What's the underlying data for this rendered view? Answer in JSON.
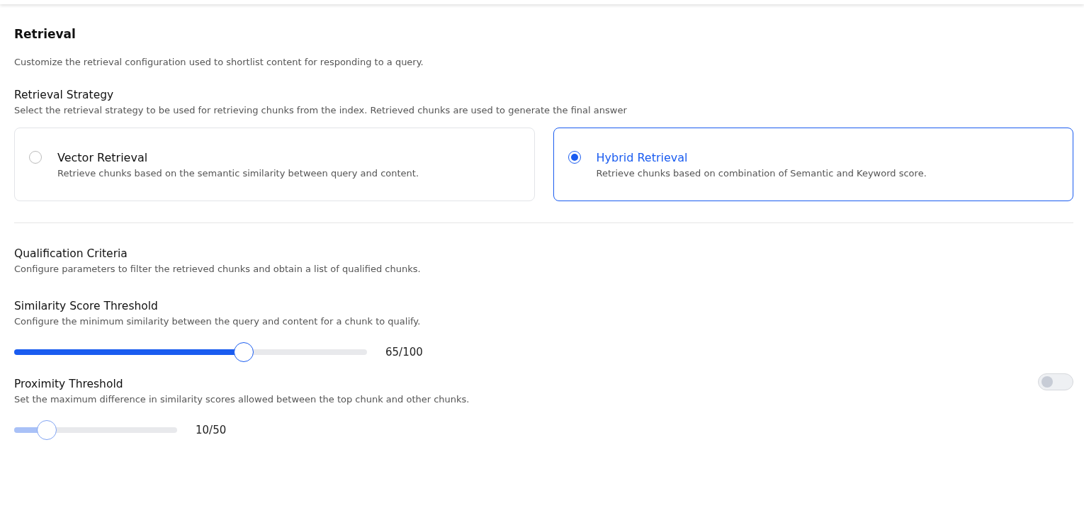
{
  "section": {
    "title": "Retrieval",
    "description": "Customize the retrieval configuration used to shortlist content for responding to a query."
  },
  "strategy": {
    "title": "Retrieval Strategy",
    "description": "Select the retrieval strategy to be used for retrieving chunks from the index. Retrieved chunks are used to generate the final answer",
    "options": [
      {
        "label": "Vector Retrieval",
        "description": "Retrieve chunks based on the semantic similarity between query and content.",
        "selected": false
      },
      {
        "label": "Hybrid Retrieval",
        "description": "Retrieve chunks based on combination of Semantic and Keyword score.",
        "selected": true
      }
    ]
  },
  "qualification": {
    "title": "Qualification Criteria",
    "description": "Configure parameters to filter the retrieved chunks and obtain a list of qualified chunks."
  },
  "thresholds": [
    {
      "kind": "plain",
      "title": "Similarity Score Threshold",
      "description": "Configure the minimum similarity between the query and content for a chunk to qualify.",
      "level": 0.65,
      "reading": "65/100"
    },
    {
      "kind": "toggle",
      "title": "Proximity Threshold",
      "description": "Set the maximum difference in similarity scores allowed between the top chunk and other chunks.",
      "level": 0.2,
      "reading": "10/50",
      "on": false
    }
  ]
}
